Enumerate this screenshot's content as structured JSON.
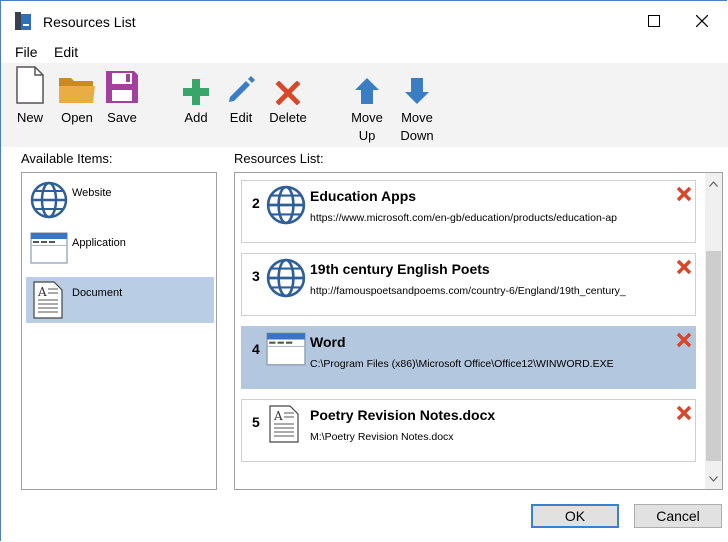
{
  "window": {
    "title": "Resources List"
  },
  "menu": {
    "items": [
      "File",
      "Edit"
    ]
  },
  "toolbar": {
    "new": "New",
    "open": "Open",
    "save": "Save",
    "add": "Add",
    "edit": "Edit",
    "delete": "Delete",
    "move_up_1": "Move",
    "move_up_2": "Up",
    "move_down_1": "Move",
    "move_down_2": "Down"
  },
  "available": {
    "label": "Available Items:",
    "items": [
      {
        "label": "Website",
        "icon": "globe-icon"
      },
      {
        "label": "Application",
        "icon": "application-window-icon"
      },
      {
        "label": "Document",
        "icon": "document-icon",
        "selected": true
      }
    ]
  },
  "resources": {
    "label": "Resources List:",
    "items": [
      {
        "num": "2",
        "title": "Education Apps",
        "path": "https://www.microsoft.com/en-gb/education/products/education-ap",
        "icon": "globe-icon"
      },
      {
        "num": "3",
        "title": "19th century English Poets",
        "path": "http://famouspoetsandpoems.com/country-6/England/19th_century_",
        "icon": "globe-icon"
      },
      {
        "num": "4",
        "title": "Word",
        "path": "C:\\Program Files (x86)\\Microsoft Office\\Office12\\WINWORD.EXE",
        "icon": "application-window-icon",
        "selected": true
      },
      {
        "num": "5",
        "title": "Poetry Revision Notes.docx",
        "path": "M:\\Poetry Revision Notes.docx",
        "icon": "document-icon"
      }
    ]
  },
  "buttons": {
    "ok": "OK",
    "cancel": "Cancel"
  },
  "colors": {
    "selection": "#b3c7de",
    "delete": "#d9472b",
    "add": "#3aa56b",
    "arrow": "#3b7dc4",
    "save": "#a33f9e",
    "folder": "#e8a93b"
  }
}
